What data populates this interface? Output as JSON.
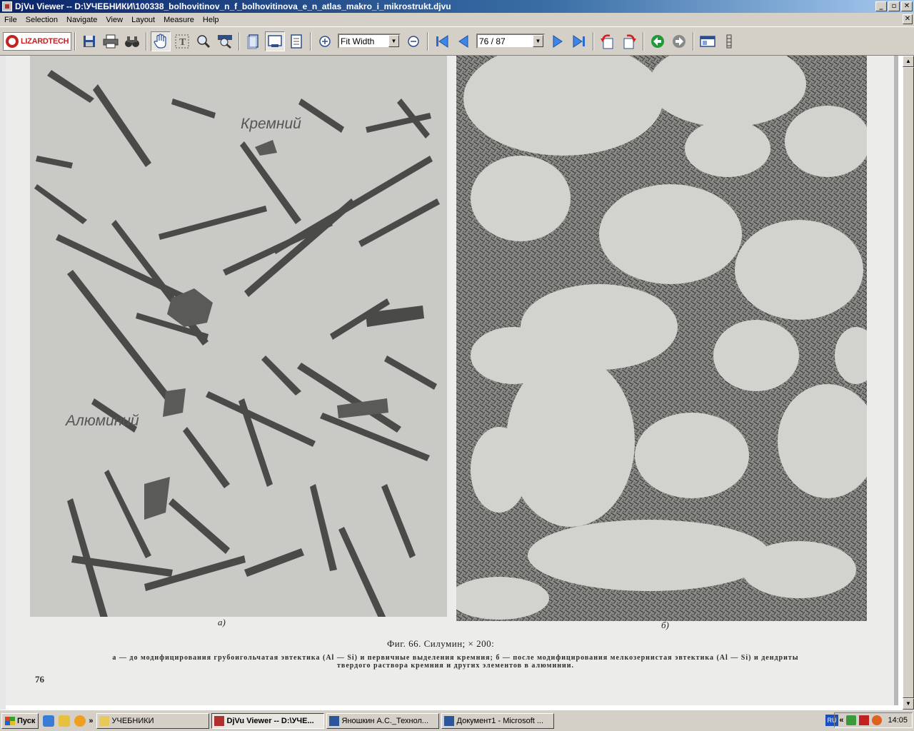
{
  "window": {
    "title": "DjVu Viewer -- D:\\УЧЕБНИКИ\\100338_bolhovitinov_n_f_bolhovitinova_e_n_atlas_makro_i_mikrostrukt.djvu",
    "minimize": "_",
    "maximize": "▫",
    "close": "✕"
  },
  "menu": {
    "items": [
      "File",
      "Selection",
      "Navigate",
      "View",
      "Layout",
      "Measure",
      "Help"
    ],
    "mdi_close": "✕"
  },
  "toolbar": {
    "logo_text": "LIZARDTECH",
    "zoom_value": "Fit Width",
    "page_value": "76 / 87"
  },
  "page": {
    "label_silicon": "Кремний",
    "label_aluminium": "Алюминий",
    "sub_a": "а)",
    "sub_b": "б)",
    "caption": "Фиг.  66.  Силумин;  × 200:",
    "desc_line1": "а — до модифицирования грубоигольчатая эвтектика (Al — Si) и первичные выделения кремния; б — после модифицирования мелкозернистая эвтектика (Al — Si) и дендриты",
    "desc_line2": "твердого раствора кремния и других элементов в алюминии.",
    "page_number": "76"
  },
  "taskbar": {
    "start_label": "Пуск",
    "overflow_chevron": "»",
    "tasks": [
      {
        "label": "УЧЕБНИКИ",
        "active": false
      },
      {
        "label": "DjVu Viewer -- D:\\УЧЕ...",
        "active": true
      },
      {
        "label": "Яношкин А.С._Технол...",
        "active": false
      },
      {
        "label": "Документ1 - Microsoft ...",
        "active": false
      }
    ],
    "lang": "RU",
    "tray_chevron": "«",
    "clock": "14:05"
  }
}
